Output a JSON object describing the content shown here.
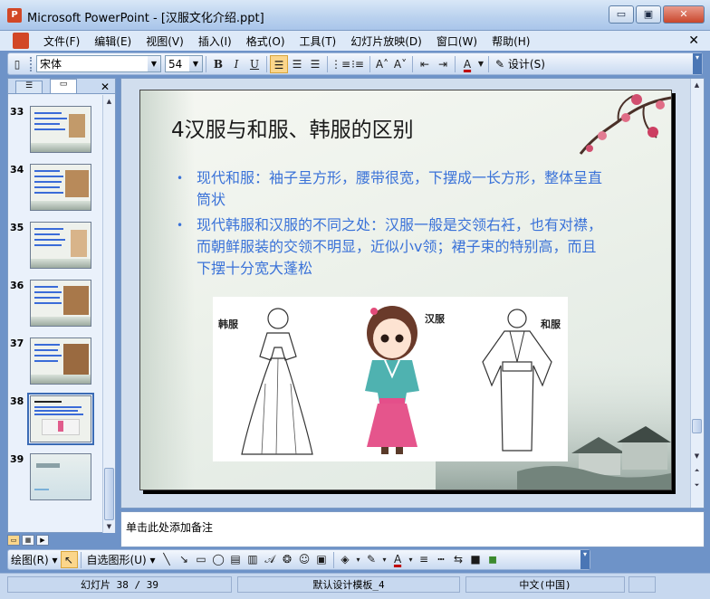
{
  "window": {
    "title": "Microsoft PowerPoint - [汉服文化介绍.ppt]",
    "minimize_glyph": "▭",
    "restore_glyph": "▣",
    "close_glyph": "✕"
  },
  "menu": {
    "items": [
      "文件(F)",
      "编辑(E)",
      "视图(V)",
      "插入(I)",
      "格式(O)",
      "工具(T)",
      "幻灯片放映(D)",
      "窗口(W)",
      "帮助(H)"
    ],
    "close_glyph": "✕"
  },
  "toolbar": {
    "font_name": "宋体",
    "font_size": "54",
    "bold": "B",
    "italic": "I",
    "underline": "U",
    "grow_font": "A˄",
    "shrink_font": "A˅",
    "font_color": "A",
    "design_label": "设计(S)"
  },
  "slides_panel": {
    "thumbnails": [
      {
        "number": "33"
      },
      {
        "number": "34"
      },
      {
        "number": "35"
      },
      {
        "number": "36"
      },
      {
        "number": "37"
      },
      {
        "number": "38",
        "selected": true
      },
      {
        "number": "39"
      }
    ]
  },
  "slide": {
    "title": "4汉服与和服、韩服的区别",
    "bullets": [
      "现代和服：袖子呈方形，腰带很宽，下摆成一长方形，整体呈直筒状",
      "现代韩服和汉服的不同之处：汉服一般是交领右衽，也有对襟，而朝鲜服装的交领不明显，近似小v领；裙子束的特别高，而且下摆十分宽大蓬松"
    ],
    "picture_labels": {
      "hanbok": "韩服",
      "hanfu": "汉服",
      "kimono": "和服"
    },
    "title_color": "#1a1a1a",
    "bullet_color": "#3a72d8"
  },
  "notes": {
    "placeholder": "单击此处添加备注"
  },
  "drawing_toolbar": {
    "draw_label": "绘图(R)",
    "autoshapes_label": "自选图形(U)"
  },
  "status": {
    "slide_position": "幻灯片 38 / 39",
    "template": "默认设计模板_4",
    "language": "中文(中国)"
  }
}
